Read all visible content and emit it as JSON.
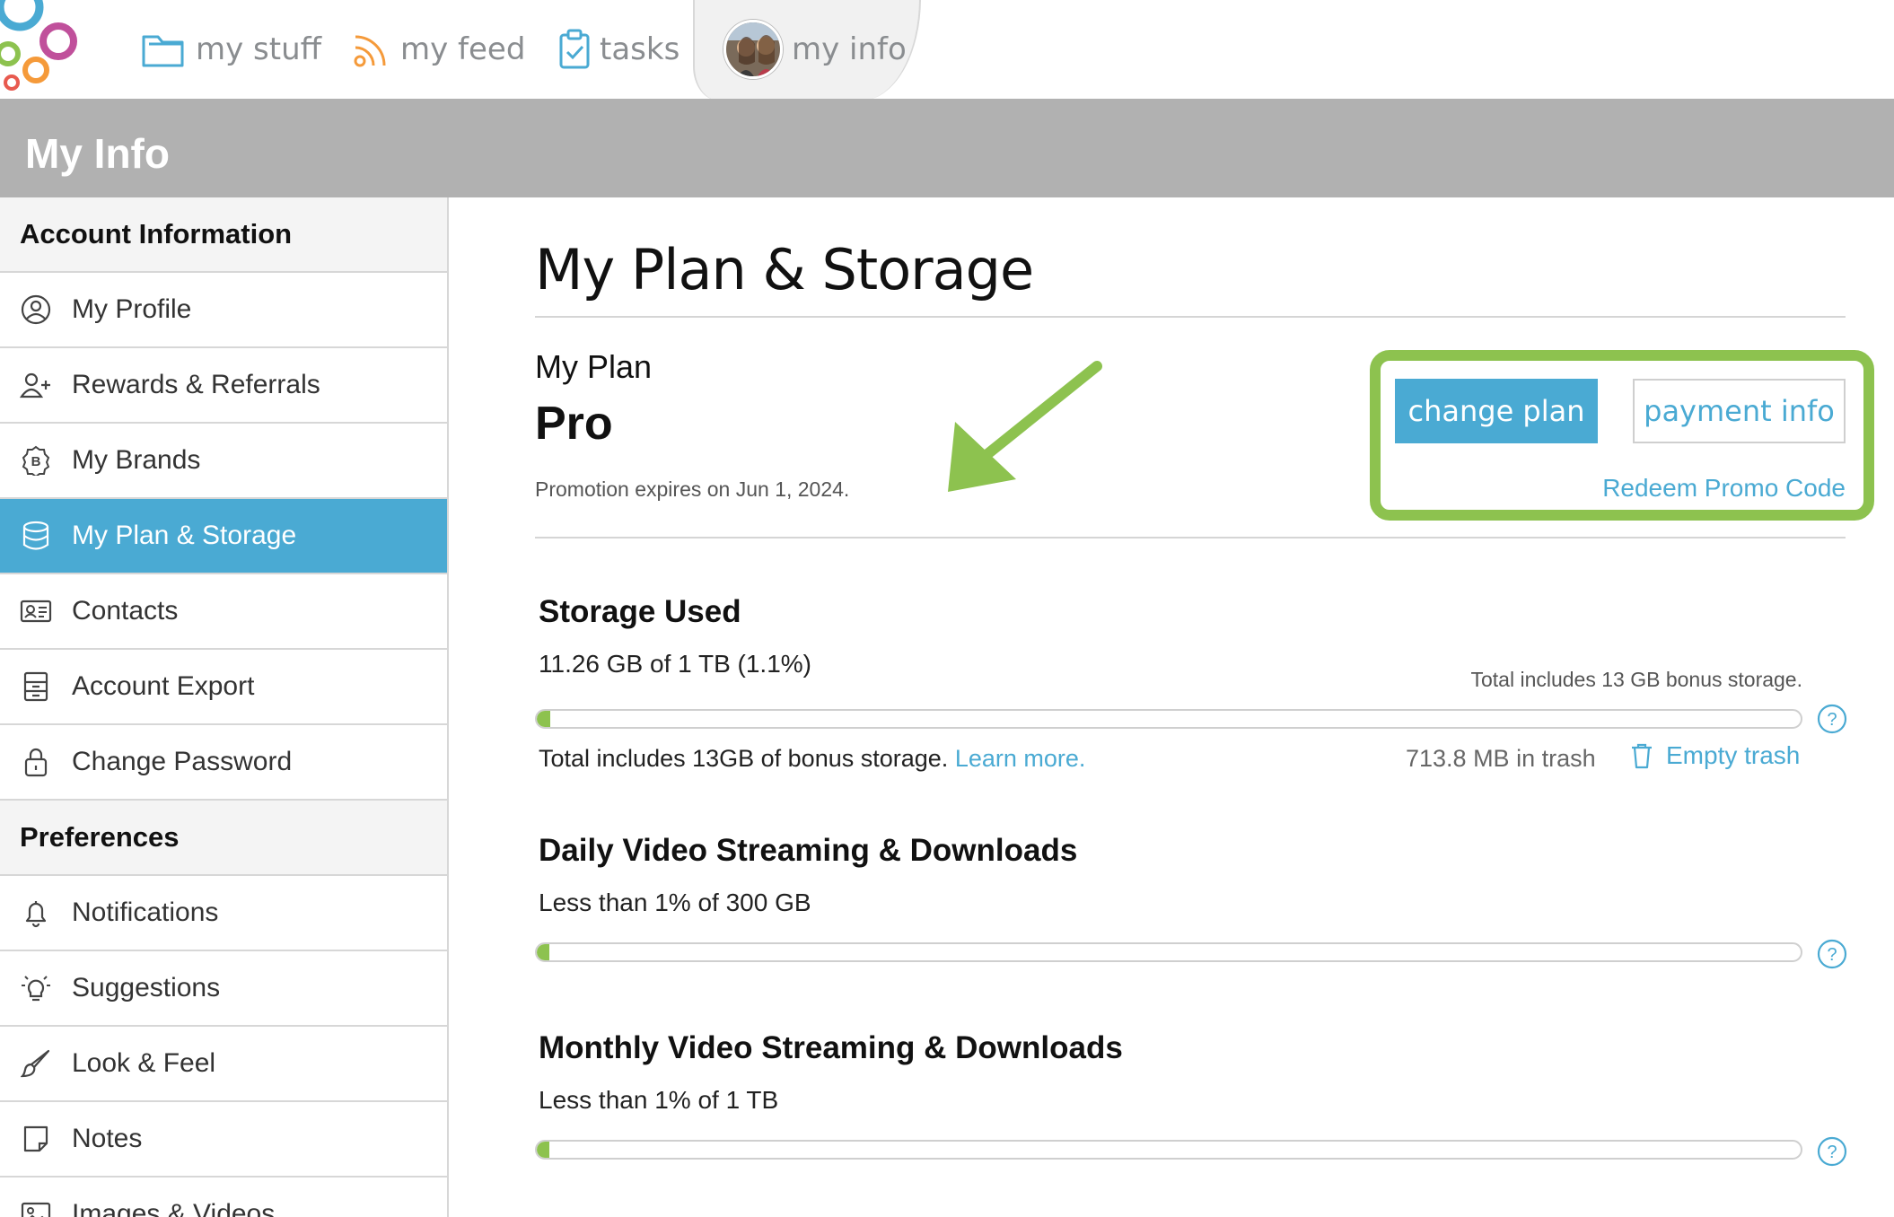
{
  "nav": {
    "items": [
      {
        "label": "my stuff",
        "icon": "folder-icon"
      },
      {
        "label": "my feed",
        "icon": "rss-icon"
      },
      {
        "label": "tasks",
        "icon": "clipboard-check-icon"
      },
      {
        "label": "my info",
        "icon": "avatar"
      }
    ],
    "active": "my info"
  },
  "header": {
    "title": "My Info"
  },
  "sidebar": {
    "sections": [
      {
        "title": "Account Information",
        "items": [
          {
            "label": "My Profile",
            "icon": "user-circle-icon"
          },
          {
            "label": "Rewards & Referrals",
            "icon": "user-plus-icon"
          },
          {
            "label": "My Brands",
            "icon": "brand-icon"
          },
          {
            "label": "My Plan & Storage",
            "icon": "database-icon",
            "active": true
          },
          {
            "label": "Contacts",
            "icon": "contact-card-icon"
          },
          {
            "label": "Account Export",
            "icon": "export-icon"
          },
          {
            "label": "Change Password",
            "icon": "lock-icon"
          }
        ]
      },
      {
        "title": "Preferences",
        "items": [
          {
            "label": "Notifications",
            "icon": "bell-icon"
          },
          {
            "label": "Suggestions",
            "icon": "lightbulb-icon"
          },
          {
            "label": "Look & Feel",
            "icon": "brush-icon"
          },
          {
            "label": "Notes",
            "icon": "note-icon"
          },
          {
            "label": "Images & Videos",
            "icon": "image-icon"
          }
        ]
      }
    ]
  },
  "main": {
    "title": "My Plan & Storage",
    "plan": {
      "label": "My Plan",
      "name": "Pro",
      "promo": "Promotion expires on Jun 1, 2024.",
      "change_plan": "change plan",
      "payment_info": "payment info",
      "redeem": "Redeem Promo Code"
    },
    "storage": {
      "title": "Storage Used",
      "usage": "11.26 GB of 1 TB (1.1%)",
      "percent": 1.1,
      "bonus_right": "Total includes 13 GB bonus storage.",
      "bonus_left": "Total includes 13GB of bonus storage.",
      "learn_more": "Learn more.",
      "trash": "713.8 MB in trash",
      "empty_trash": "Empty trash"
    },
    "daily": {
      "title": "Daily Video Streaming & Downloads",
      "usage": "Less than 1% of 300 GB",
      "percent": 1
    },
    "monthly": {
      "title": "Monthly Video Streaming & Downloads",
      "usage": "Less than 1% of 1 TB",
      "percent": 1
    }
  },
  "colors": {
    "accent": "#4aaad3",
    "highlight": "#8dc24f",
    "header_bg": "#b1b1b1",
    "bar_fill": "#8dc24f"
  }
}
